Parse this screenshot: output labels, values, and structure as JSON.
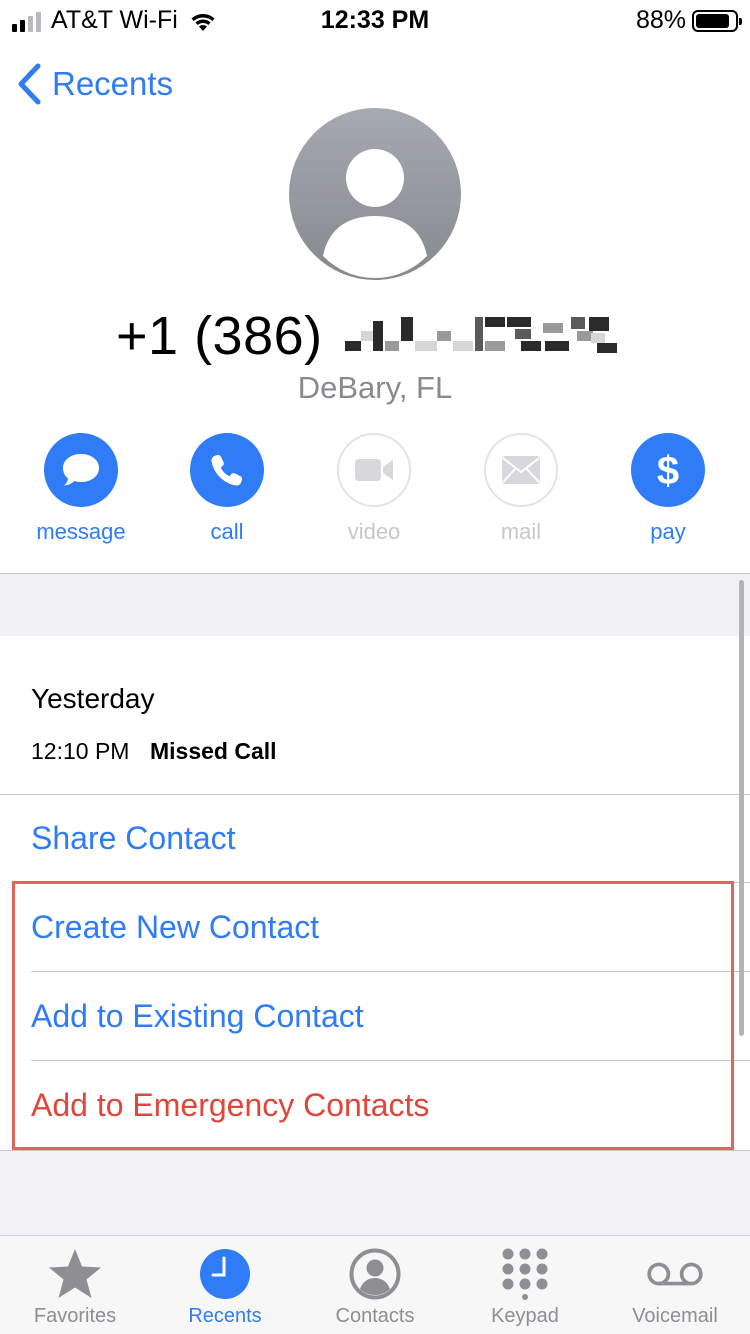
{
  "status_bar": {
    "carrier": "AT&T Wi-Fi",
    "time": "12:33 PM",
    "battery_percent": "88%",
    "battery_level": 0.88,
    "signal_bars_active": 2,
    "signal_bars_total": 4
  },
  "nav": {
    "back_label": "Recents",
    "back_icon": "chevron-left-icon"
  },
  "contact": {
    "phone_number": "+1 (386)",
    "phone_redacted": true,
    "location": "DeBary, FL"
  },
  "actions": [
    {
      "label": "message",
      "icon": "message-bubble-icon",
      "enabled": true
    },
    {
      "label": "call",
      "icon": "phone-icon",
      "enabled": true
    },
    {
      "label": "video",
      "icon": "video-camera-icon",
      "enabled": false
    },
    {
      "label": "mail",
      "icon": "envelope-icon",
      "enabled": false
    },
    {
      "label": "pay",
      "icon": "dollar-icon",
      "enabled": true
    }
  ],
  "call_history": {
    "day": "Yesterday",
    "time": "12:10 PM",
    "type": "Missed Call"
  },
  "options": {
    "share": "Share Contact",
    "create_new": "Create New Contact",
    "add_existing": "Add to Existing Contact",
    "add_emergency": "Add to Emergency Contacts"
  },
  "tab_bar": [
    {
      "label": "Favorites",
      "icon": "star-icon",
      "active": false
    },
    {
      "label": "Recents",
      "icon": "clock-icon",
      "active": true
    },
    {
      "label": "Contacts",
      "icon": "person-circle-icon",
      "active": false
    },
    {
      "label": "Keypad",
      "icon": "keypad-icon",
      "active": false
    },
    {
      "label": "Voicemail",
      "icon": "voicemail-icon",
      "active": false
    }
  ],
  "colors": {
    "accent": "#2f7cf6",
    "destructive": "#e0463a",
    "highlight_box": "#e0665b",
    "secondary_text": "#8a8a8e"
  }
}
